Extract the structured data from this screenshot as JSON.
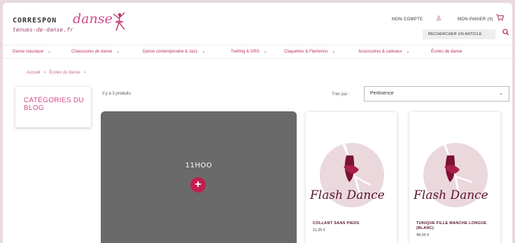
{
  "header": {
    "logo_main": "CORRESPON",
    "logo_script": "danse",
    "logo_sub": "tenues-de-danse.fr",
    "account_label": "MON COMPTE",
    "cart_label": "MON PANIER (0)",
    "search_placeholder": "RECHERCHER UN ARTICLE"
  },
  "nav": {
    "items": [
      {
        "label": "Danse classique"
      },
      {
        "label": "Chaussures de danse"
      },
      {
        "label": "Danse contemporaine & Jazz"
      },
      {
        "label": "Twirling & GRS"
      },
      {
        "label": "Claquettes & Flamenco"
      },
      {
        "label": "Accessoires & cadeaux"
      },
      {
        "label": "Écoles de danse"
      }
    ]
  },
  "breadcrumb": {
    "items": [
      "Accueil",
      ">",
      "Écoles de danse",
      ">"
    ]
  },
  "sidebar": {
    "title": "CATÉGORIES DU BLOG"
  },
  "listing": {
    "count_text": "Il y a 3 produits.",
    "sort_label": "Trier par :",
    "sort_value": "Pertinence"
  },
  "promo": {
    "title": "11HOO"
  },
  "products": [
    {
      "name": "COLLANT SANS PIEDS",
      "price": "11,25 €",
      "brand_script": "Flash Dance"
    },
    {
      "name": "TUNIQUE FILLE MANCHE LONGUE (BLANC)",
      "price": "48,05 €",
      "brand_script": "Flash Dance"
    }
  ],
  "colors": {
    "accent": "#b8325f",
    "pink": "#d24b8a",
    "promo_bg": "#6a6a6a",
    "plus_bg": "#c21e4f",
    "card_circle": "#ead8dd",
    "skirt": "#7a1233"
  }
}
